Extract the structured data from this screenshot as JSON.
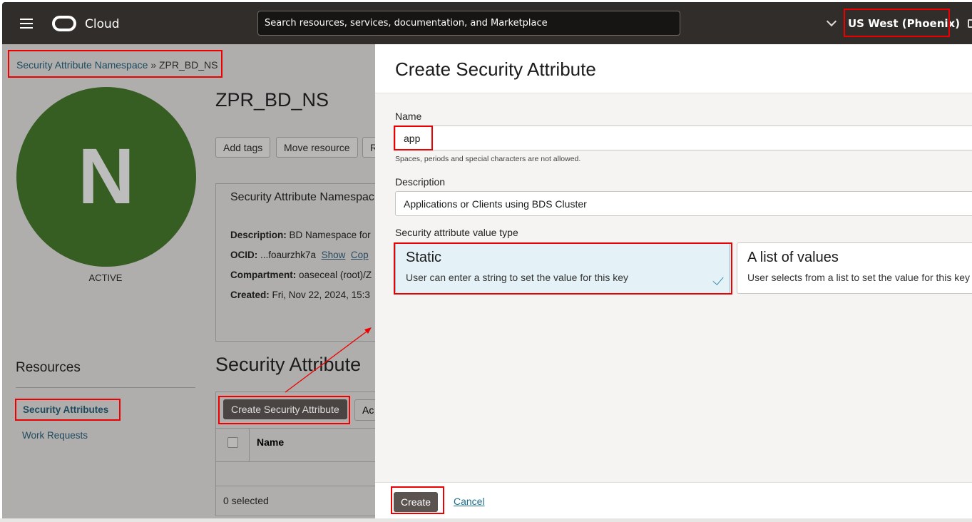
{
  "topbar": {
    "brand": "Cloud",
    "search_placeholder": "Search resources, services, documentation, and Marketplace",
    "region": "US West (Phoenix)"
  },
  "breadcrumb": {
    "parent": "Security Attribute Namespace",
    "separator": "»",
    "current": "ZPR_BD_NS"
  },
  "namespace": {
    "avatar_letter": "N",
    "status": "ACTIVE",
    "title": "ZPR_BD_NS",
    "avatar_color": "#365e22",
    "actions": [
      "Add tags",
      "Move resource",
      "R"
    ],
    "info": {
      "heading": "Security Attribute Namespac",
      "description_label": "Description:",
      "description": "BD Namespace for",
      "ocid_label": "OCID:",
      "ocid": "...foaurzhk7a",
      "show": "Show",
      "copy": "Cop",
      "compartment_label": "Compartment:",
      "compartment": "oaseceal (root)/Z",
      "created_label": "Created:",
      "created": "Fri, Nov 22, 2024, 15:3"
    }
  },
  "resources": {
    "heading": "Resources",
    "items": [
      "Security Attributes",
      "Work Requests"
    ]
  },
  "attributes": {
    "heading": "Security Attribute",
    "create_button": "Create Security Attribute",
    "actions_button": "Ac",
    "name_col": "Name",
    "selected": "0 selected"
  },
  "panel": {
    "title": "Create Security Attribute",
    "name_label": "Name",
    "name_value": "app",
    "name_hint": "Spaces, periods and special characters are not allowed.",
    "description_label": "Description",
    "description_value": "Applications or Clients using BDS Cluster",
    "type_label": "Security attribute value type",
    "options": [
      {
        "title": "Static",
        "desc": "User can enter a string to set the value for this key",
        "selected": true
      },
      {
        "title": "A list of values",
        "desc": "User selects from a list to set the value for this key",
        "selected": false
      }
    ],
    "create": "Create",
    "cancel": "Cancel"
  },
  "colors": {
    "annotation": "#e00000",
    "topbar": "#312d2a",
    "link": "#1f6f8b"
  }
}
